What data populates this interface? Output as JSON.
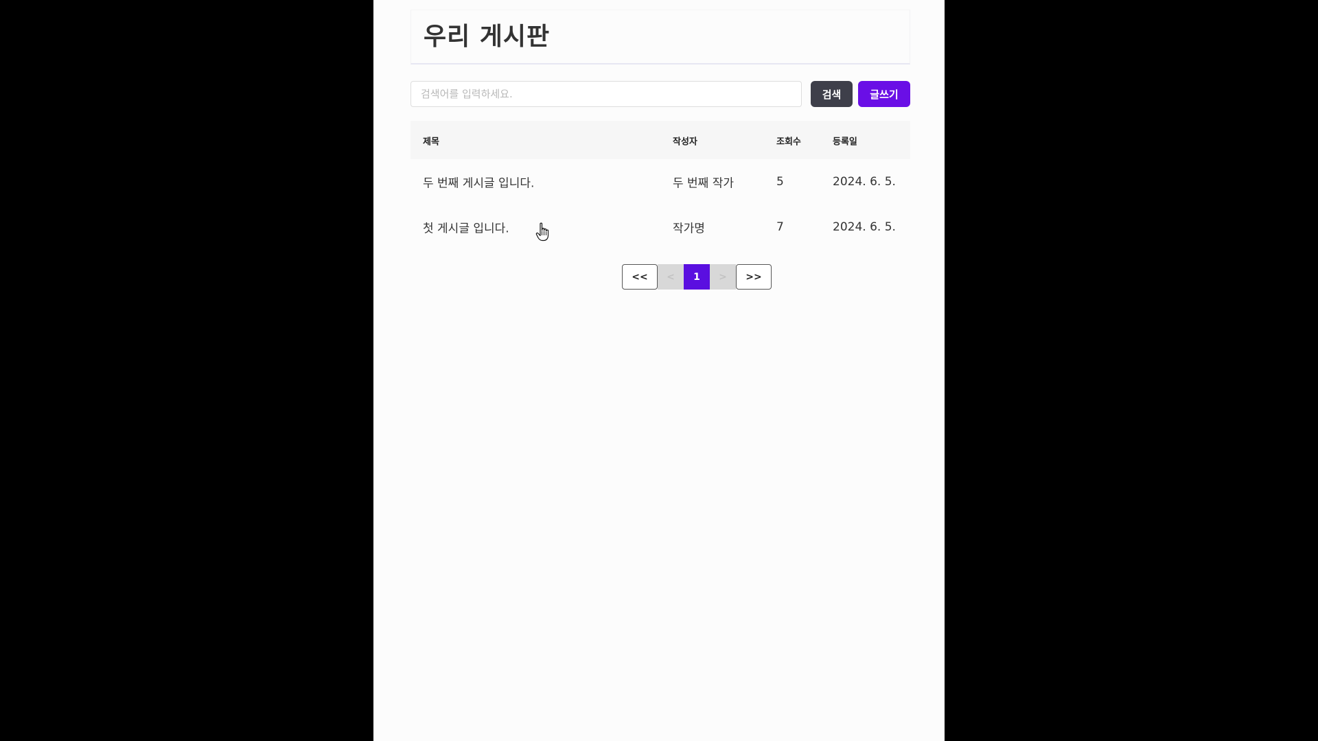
{
  "header": {
    "title": "우리 게시판"
  },
  "toolbar": {
    "search_placeholder": "검색어를 입력하세요.",
    "search_value": "",
    "search_button": "검색",
    "write_button": "글쓰기"
  },
  "table": {
    "headers": {
      "title": "제목",
      "author": "작성자",
      "views": "조회수",
      "date": "등록일"
    },
    "rows": [
      {
        "title": "두 번째 게시글 입니다.",
        "author": "두 번째 작가",
        "views": "5",
        "date": "2024. 6. 5."
      },
      {
        "title": "첫 게시글 입니다.",
        "author": "작가명",
        "views": "7",
        "date": "2024. 6. 5."
      }
    ]
  },
  "pagination": {
    "first": "<<",
    "prev": "<",
    "current": "1",
    "next": ">",
    "last": ">>"
  },
  "colors": {
    "accent": "#6a0fe6",
    "search_button": "#3e3f4a",
    "page_background": "#fcfcfc",
    "outer_background": "#000000"
  },
  "icons": {
    "mouse_cursor": "hand-pointer-icon"
  }
}
